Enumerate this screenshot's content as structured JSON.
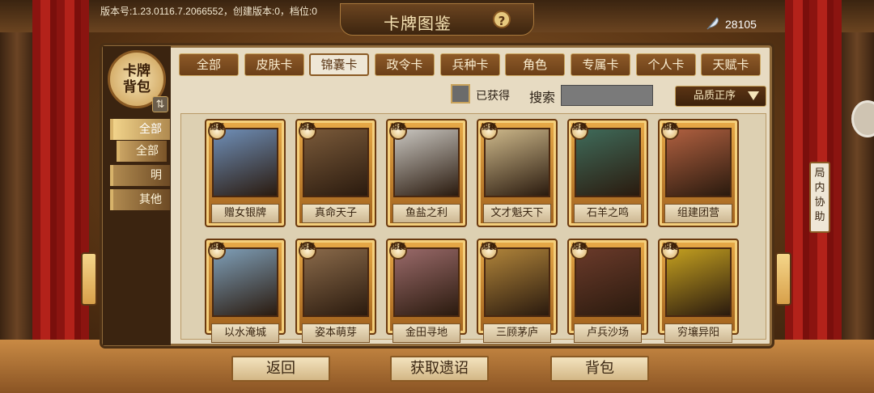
{
  "app": {
    "version_text": "版本号:1.23.0116.7.2066552，创建版本:0，档位:0",
    "title": "卡牌图鉴",
    "help_icon": "?",
    "currency": {
      "icon": "feather-icon",
      "value": "28105"
    }
  },
  "sidebar": {
    "logo_text": "卡牌背包",
    "swap_icon": "⇅",
    "items": [
      {
        "label": "全部",
        "state": "active"
      },
      {
        "label": "全部",
        "state": "sub"
      },
      {
        "label": "明",
        "state": "normal"
      },
      {
        "label": "其他",
        "state": "normal"
      }
    ]
  },
  "tabs": [
    {
      "label": "全部"
    },
    {
      "label": "皮肤卡"
    },
    {
      "label": "锦囊卡",
      "active": true
    },
    {
      "label": "政令卡"
    },
    {
      "label": "兵种卡"
    },
    {
      "label": "角色"
    },
    {
      "label": "专属卡"
    },
    {
      "label": "个人卡"
    },
    {
      "label": "天赋卡"
    }
  ],
  "filters": {
    "obtained_label": "已获得",
    "search_label": "搜索",
    "search_value": "",
    "sort_label": "品质正序"
  },
  "cards": [
    {
      "name": "赠女银牌",
      "badge": "锦囊"
    },
    {
      "name": "真命天子",
      "badge": "锦囊"
    },
    {
      "name": "鱼盐之利",
      "badge": "锦囊"
    },
    {
      "name": "文才魁天下",
      "badge": "锦囊"
    },
    {
      "name": "石羊之鸣",
      "badge": "锦囊"
    },
    {
      "name": "组建团营",
      "badge": "锦囊"
    },
    {
      "name": "以水淹城",
      "badge": "锦囊"
    },
    {
      "name": "姿本萌芽",
      "badge": "锦囊"
    },
    {
      "name": "金田寻地",
      "badge": "锦囊"
    },
    {
      "name": "三顾茅庐",
      "badge": "锦囊"
    },
    {
      "name": "卢兵沙场",
      "badge": "锦囊"
    },
    {
      "name": "穷壤异阳",
      "badge": "锦囊"
    }
  ],
  "card_colors": [
    "#6f8fb8",
    "#7a5a3a",
    "#c9c6c0",
    "#cdb88a",
    "#3f6b5a",
    "#b06040",
    "#7f9fb8",
    "#8a6a4a",
    "#9a6a6a",
    "#b0843a",
    "#6a3a2a",
    "#c4a020"
  ],
  "helper_tab": "局内协助",
  "bottom_buttons": {
    "back": "返回",
    "get_edict": "获取遗诏",
    "bag": "背包"
  }
}
